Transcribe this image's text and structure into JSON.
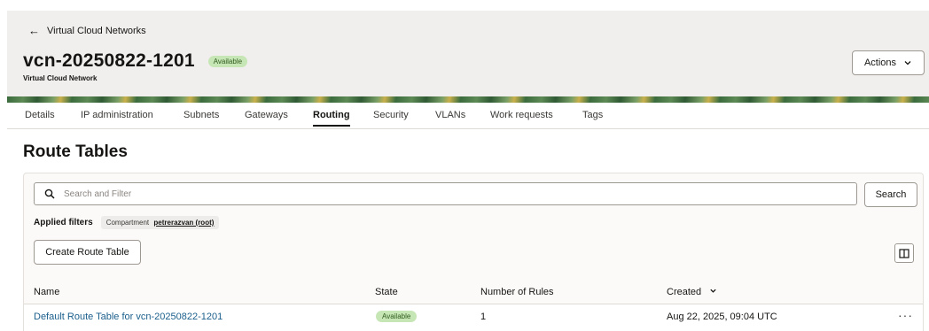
{
  "header": {
    "back_label": "Virtual Cloud Networks",
    "title": "vcn-20250822-1201",
    "status": "Available",
    "subtitle": "Virtual Cloud Network",
    "actions_label": "Actions"
  },
  "tabs": [
    {
      "label": "Details",
      "active": false
    },
    {
      "label": "IP administration",
      "active": false
    },
    {
      "label": "Subnets",
      "active": false
    },
    {
      "label": "Gateways",
      "active": false
    },
    {
      "label": "Routing",
      "active": true
    },
    {
      "label": "Security",
      "active": false
    },
    {
      "label": "VLANs",
      "active": false
    },
    {
      "label": "Work requests",
      "active": false
    },
    {
      "label": "Tags",
      "active": false
    }
  ],
  "section": {
    "title": "Route Tables"
  },
  "search": {
    "placeholder": "Search and Filter",
    "button_label": "Search"
  },
  "filters": {
    "label": "Applied filters",
    "chip_key": "Compartment",
    "chip_value": "petrerazvan (root)"
  },
  "toolbar": {
    "create_label": "Create Route Table"
  },
  "table": {
    "columns": [
      "Name",
      "State",
      "Number of Rules",
      "Created"
    ],
    "rows": [
      {
        "name": "Default Route Table for vcn-20250822-1201",
        "state": "Available",
        "rules": "1",
        "created": "Aug 22, 2025, 09:04 UTC"
      }
    ]
  },
  "icons": {
    "back": "arrow-left-icon",
    "actions": "chevron-down-icon",
    "search": "search-icon",
    "columns": "columns-icon",
    "sort": "chevron-down-icon",
    "row_menu": "more-horizontal-icon"
  },
  "colors": {
    "header_bg": "#f1efed",
    "status_bg": "#c7e6b5",
    "link": "#1b5f8c",
    "text": "#161513"
  }
}
